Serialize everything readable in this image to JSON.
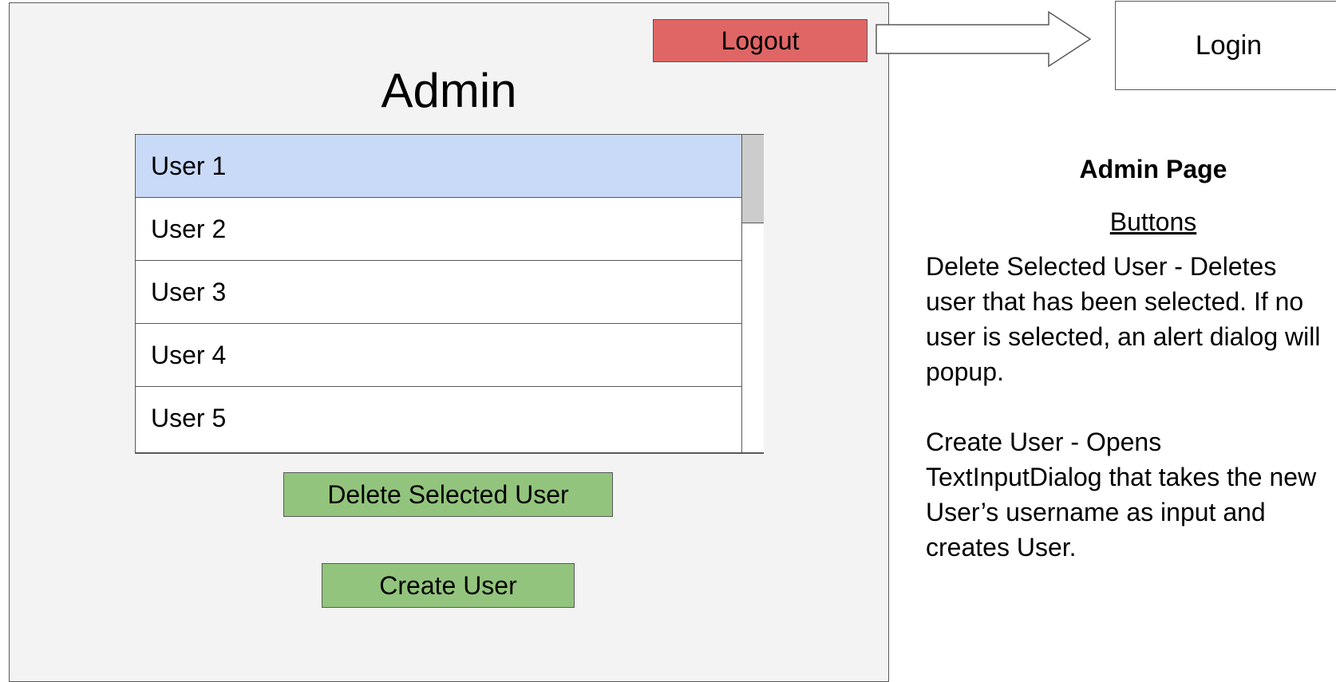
{
  "header": {
    "logout_label": "Logout",
    "login_label": "Login"
  },
  "main": {
    "title": "Admin",
    "users": [
      {
        "label": "User 1",
        "selected": true
      },
      {
        "label": "User 2",
        "selected": false
      },
      {
        "label": "User 3",
        "selected": false
      },
      {
        "label": "User 4",
        "selected": false
      },
      {
        "label": "User 5",
        "selected": false
      }
    ],
    "scrollbar": {
      "visible_fraction": 0.28,
      "position": 0
    },
    "delete_label": "Delete Selected User",
    "create_label": "Create User"
  },
  "notes": {
    "heading": "Admin Page",
    "subheading": "Buttons",
    "delete_description": "Delete Selected User - Deletes user that has been selected. If no user is selected, an alert dialog will popup.",
    "create_description": "Create User - Opens TextInputDialog that takes the new User’s username as input and creates User."
  },
  "colors": {
    "frame_bg": "#f3f3f3",
    "logout_bg": "#e06666",
    "button_green": "#93c47d",
    "selected_row": "#c9daf8",
    "scroll_thumb": "#cccccc",
    "border": "#595959"
  },
  "icons": {
    "flow_arrow": "right-arrow-icon"
  }
}
